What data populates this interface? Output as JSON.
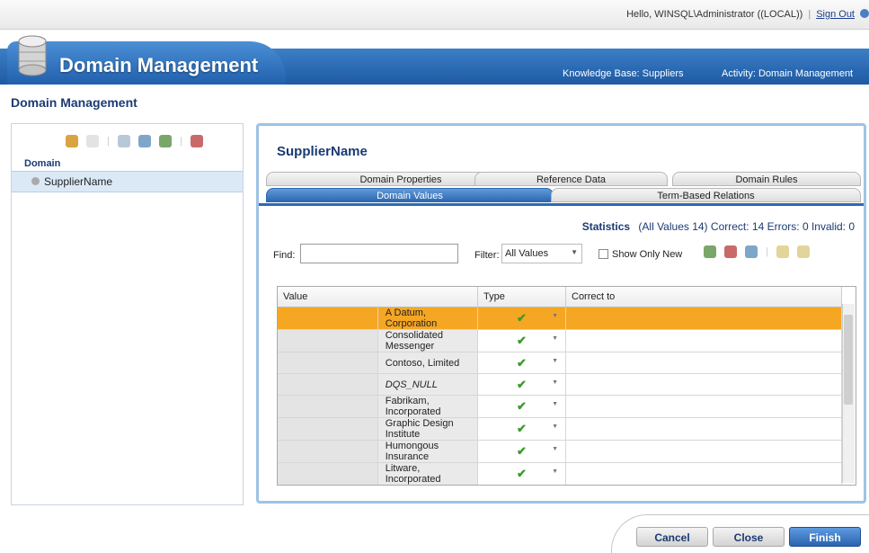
{
  "header": {
    "greeting": "Hello, WINSQL\\Administrator ((LOCAL))",
    "sign_out": "Sign Out"
  },
  "banner": {
    "title": "Domain Management",
    "knowledge_base": "Knowledge Base: Suppliers",
    "activity": "Activity: Domain Management"
  },
  "page": {
    "title": "Domain Management"
  },
  "left": {
    "domain_header": "Domain",
    "domains": [
      "SupplierName"
    ]
  },
  "right": {
    "entity_title": "SupplierName",
    "tabs_top": [
      "Domain Properties",
      "Reference Data",
      "Domain Rules"
    ],
    "tabs_bottom": [
      "Domain Values",
      "Term-Based Relations"
    ],
    "active_tab": "Domain Values",
    "statistics": {
      "label": "Statistics",
      "all_values": "(All Values 14)",
      "correct": "Correct: 14",
      "errors": "Errors: 0",
      "invalid": "Invalid: 0"
    },
    "find_label": "Find:",
    "find_value": "",
    "filter_label": "Filter:",
    "filter_value": "All Values",
    "show_only_new": "Show Only New"
  },
  "grid": {
    "columns": [
      "Value",
      "Type",
      "Correct to"
    ],
    "rows": [
      {
        "value": "A Datum, Corporation",
        "type": "correct",
        "correct_to": ""
      },
      {
        "value": "Consolidated Messenger",
        "type": "correct",
        "correct_to": ""
      },
      {
        "value": "Contoso, Limited",
        "type": "correct",
        "correct_to": ""
      },
      {
        "value": "DQS_NULL",
        "type": "correct",
        "correct_to": ""
      },
      {
        "value": "Fabrikam, Incorporated",
        "type": "correct",
        "correct_to": ""
      },
      {
        "value": "Graphic Design Institute",
        "type": "correct",
        "correct_to": ""
      },
      {
        "value": "Humongous Insurance",
        "type": "correct",
        "correct_to": ""
      },
      {
        "value": "Litware, Incorporated",
        "type": "correct",
        "correct_to": ""
      }
    ],
    "selected_row": 0
  },
  "buttons": {
    "cancel": "Cancel",
    "close": "Close",
    "finish": "Finish"
  },
  "colors": {
    "accent": "#2d69b2",
    "selection": "#f5a623",
    "check": "#3a9b2a"
  }
}
